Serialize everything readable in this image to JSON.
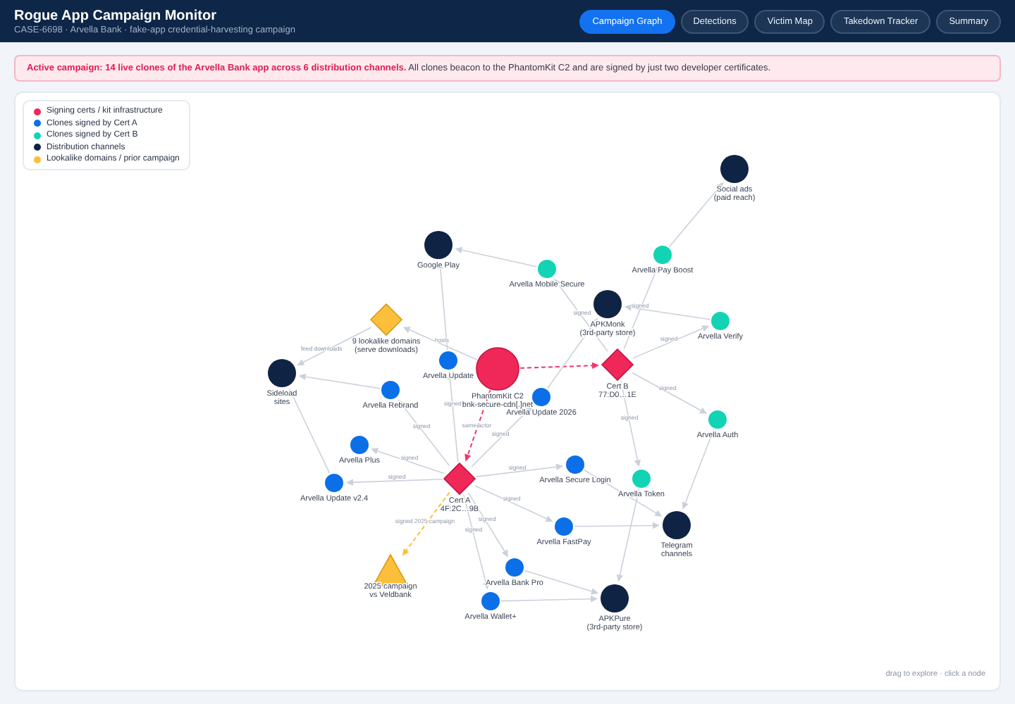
{
  "header": {
    "title": "Rogue App Campaign Monitor",
    "subtitle": "CASE-6698 · Arvella Bank · fake-app credential-harvesting campaign"
  },
  "tabs": [
    {
      "label": "Campaign Graph",
      "selected": true
    },
    {
      "label": "Detections",
      "selected": false
    },
    {
      "label": "Victim Map",
      "selected": false
    },
    {
      "label": "Takedown Tracker",
      "selected": false
    },
    {
      "label": "Summary",
      "selected": false
    }
  ],
  "alert": {
    "text": "**Active campaign: 14 live clones of the Arvella Bank app across 6 distribution channels.** All clones beacon to the PhantomKit C2 and are signed by just two developer certificates."
  },
  "legend": [
    {
      "label": "Signing certs / kit infrastructure",
      "color": "#f0285a"
    },
    {
      "label": "Clones signed by Cert A",
      "color": "#0b6fe8"
    },
    {
      "label": "Clones signed by Cert B",
      "color": "#12d4b4"
    },
    {
      "label": "Distribution channels",
      "color": "#0f2344"
    },
    {
      "label": "Lookalike domains / prior campaign",
      "color": "#fbbf3b"
    }
  ],
  "graph": {
    "nodes": [
      {
        "kind": "c2",
        "label": "PhantomKit C2",
        "sublabel": "bnk-secure-cdn[.]net"
      },
      {
        "kind": "cert",
        "label": "Cert B",
        "sublabel": "77:D0…1E"
      },
      {
        "kind": "cert",
        "label": "Cert A",
        "sublabel": "4F:2C…9B"
      },
      {
        "kind": "channel",
        "label": "Google Play"
      },
      {
        "kind": "channel",
        "label": "Social ads",
        "sublabel": "(paid reach)"
      },
      {
        "kind": "channel",
        "label": "APKMonk",
        "sublabel": "(3rd-party store)"
      },
      {
        "kind": "channel",
        "label": "Sideload",
        "sublabel": "sites"
      },
      {
        "kind": "channel",
        "label": "Telegram",
        "sublabel": "channels"
      },
      {
        "kind": "channel",
        "label": "APKPure",
        "sublabel": "(3rd-party store)"
      },
      {
        "kind": "domains",
        "label": "9 lookalike domains",
        "sublabel": "(serve downloads)"
      },
      {
        "kind": "campaign",
        "label": "2025 campaign",
        "sublabel": "vs Veldbank"
      },
      {
        "kind": "clone_a",
        "label": "Arvella Update"
      },
      {
        "kind": "clone_a",
        "label": "Arvella Rebrand"
      },
      {
        "kind": "clone_a",
        "label": "Arvella Plus"
      },
      {
        "kind": "clone_a",
        "label": "Arvella Update v2.4"
      },
      {
        "kind": "clone_a",
        "label": "Arvella Update 2026"
      },
      {
        "kind": "clone_a",
        "label": "Arvella Secure Login"
      },
      {
        "kind": "clone_a",
        "label": "Arvella FastPay"
      },
      {
        "kind": "clone_a",
        "label": "Arvella Bank Pro"
      },
      {
        "kind": "clone_a",
        "label": "Arvella Wallet+"
      },
      {
        "kind": "clone_b",
        "label": "Arvella Mobile Secure"
      },
      {
        "kind": "clone_b",
        "label": "Arvella Pay Boost"
      },
      {
        "kind": "clone_b",
        "label": "Arvella Verify"
      },
      {
        "kind": "clone_b",
        "label": "Arvella Auth"
      },
      {
        "kind": "clone_b",
        "label": "Arvella Token"
      }
    ],
    "edges": [
      {
        "kind": "link",
        "label": "hosts"
      },
      {
        "kind": "link",
        "label": "feed downloads"
      },
      {
        "kind": "actor"
      },
      {
        "kind": "actor",
        "label": "same actor"
      },
      {
        "kind": "link",
        "label": "signed"
      },
      {
        "kind": "link",
        "label": "signed"
      },
      {
        "kind": "link",
        "label": "signed"
      },
      {
        "kind": "link",
        "label": "signed"
      },
      {
        "kind": "link",
        "label": "signed"
      },
      {
        "kind": "link",
        "label": "signed"
      },
      {
        "kind": "link",
        "label": "signed"
      },
      {
        "kind": "link",
        "label": "signed"
      },
      {
        "kind": "link",
        "label": "signed"
      },
      {
        "kind": "prior",
        "label": "signed 2025 campaign"
      },
      {
        "kind": "link",
        "label": "signed"
      },
      {
        "kind": "link",
        "label": "signed"
      },
      {
        "kind": "link",
        "label": "signed"
      },
      {
        "kind": "link",
        "label": "signed"
      },
      {
        "kind": "link",
        "label": "signed"
      },
      {
        "kind": "link"
      },
      {
        "kind": "link"
      },
      {
        "kind": "link"
      },
      {
        "kind": "link"
      },
      {
        "kind": "link"
      },
      {
        "kind": "link"
      },
      {
        "kind": "link"
      },
      {
        "kind": "link"
      },
      {
        "kind": "link"
      },
      {
        "kind": "link"
      },
      {
        "kind": "link"
      },
      {
        "kind": "link"
      },
      {
        "kind": "link"
      }
    ]
  },
  "hint": "drag to explore · click a node"
}
